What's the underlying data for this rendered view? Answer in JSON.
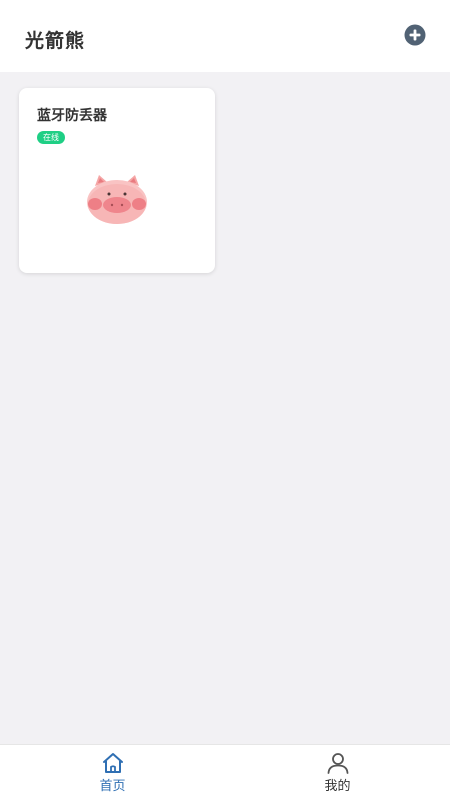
{
  "header": {
    "title": "光箭熊",
    "add_icon": "plus-circle-icon",
    "add_icon_color": "#516274"
  },
  "devices": [
    {
      "name": "蓝牙防丢器",
      "status": "在线",
      "status_color": "#1fcf85",
      "image_icon": "pig-icon"
    }
  ],
  "tabbar": {
    "active_color": "#2f6fb3",
    "inactive_color": "#333333",
    "tabs": [
      {
        "label": "首页",
        "icon": "home-icon",
        "active": true
      },
      {
        "label": "我的",
        "icon": "user-icon",
        "active": false
      }
    ]
  }
}
